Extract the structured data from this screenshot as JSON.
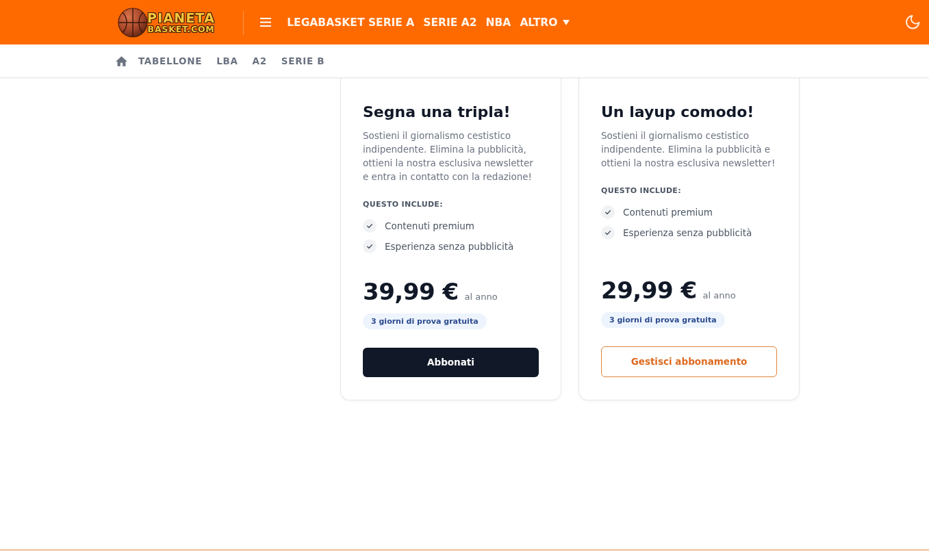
{
  "header": {
    "logo": {
      "line_1": "PIANETA",
      "line_2": "BASKET.COM"
    },
    "nav": [
      {
        "label": "LEGABASKET SERIE A",
        "dropdown": false
      },
      {
        "label": "SERIE A2",
        "dropdown": false
      },
      {
        "label": "NBA",
        "dropdown": false
      },
      {
        "label": "ALTRO",
        "dropdown": true
      }
    ]
  },
  "subnav": [
    "TABELLONE",
    "LBA",
    "A2",
    "SERIE B"
  ],
  "plans": [
    {
      "title": "Segna una tripla!",
      "description": "Sostieni il giornalismo cestistico indipendente. Elimina la pubblicità, ottieni la nostra esclusiva newsletter e entra in contatto con la redazione!",
      "includes_heading": "QUESTO INCLUDE:",
      "features": [
        "Contenuti premium",
        "Esperienza senza pubblicità"
      ],
      "price": "39,99 €",
      "period": "al anno",
      "trial_badge": "3 giorni di prova gratuita",
      "button": {
        "label": "Abbonati",
        "kind": "subscribe"
      }
    },
    {
      "title": "Un layup comodo!",
      "description": "Sostieni il giornalismo cestistico indipendente. Elimina la pubblicità e ottieni la nostra esclusiva newsletter!",
      "includes_heading": "QUESTO INCLUDE:",
      "features": [
        "Contenuti premium",
        "Esperienza senza pubblicità"
      ],
      "price": "29,99 €",
      "period": "al anno",
      "trial_badge": "3 giorni di prova gratuita",
      "button": {
        "label": "Gestisci abbonamento",
        "kind": "manage"
      }
    }
  ]
}
